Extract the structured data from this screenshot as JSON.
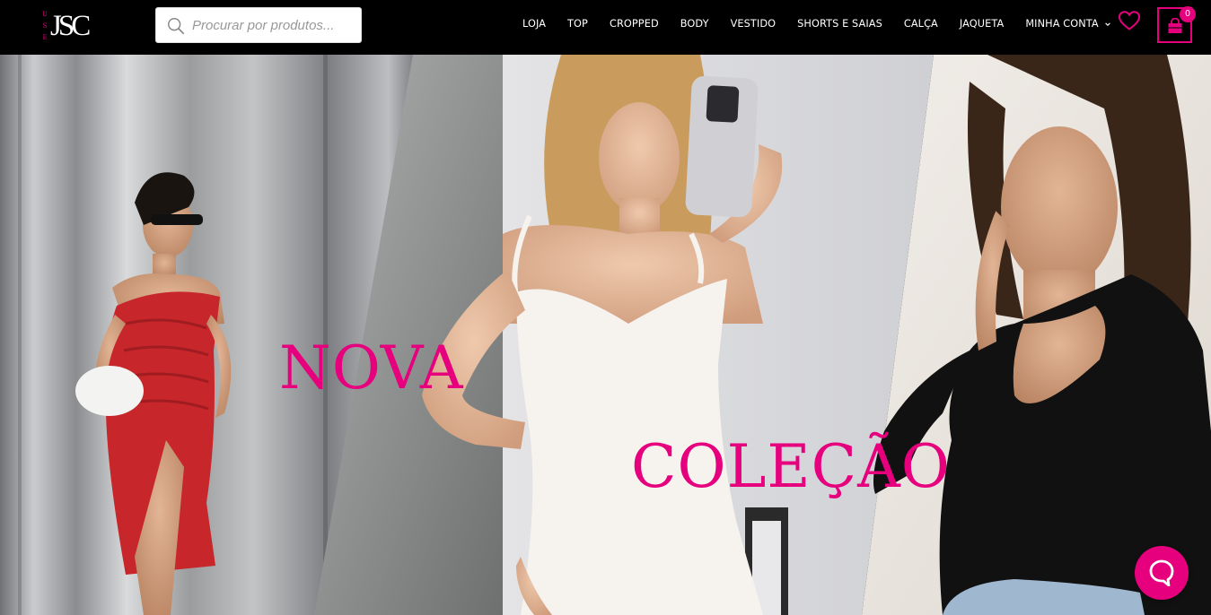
{
  "brand": {
    "logo_main": "JSC",
    "logo_side": [
      "U",
      "S",
      "E"
    ]
  },
  "search": {
    "placeholder": "Procurar por produtos..."
  },
  "nav": {
    "items": [
      "LOJA",
      "TOP",
      "CROPPED",
      "BODY",
      "VESTIDO",
      "SHORTS E SAIAS",
      "CALÇA",
      "JAQUETA",
      "MINHA CONTA"
    ]
  },
  "cart": {
    "count": "0"
  },
  "hero": {
    "line1": "NOVA",
    "line2": "COLEÇÃO"
  },
  "colors": {
    "accent": "#e6007e",
    "header_bg": "#000000"
  },
  "icons": {
    "search": "search-icon",
    "wishlist": "heart-icon",
    "cart": "shopping-bag-icon",
    "dropdown": "chevron-down-icon",
    "chat": "chat-bubble-icon"
  }
}
